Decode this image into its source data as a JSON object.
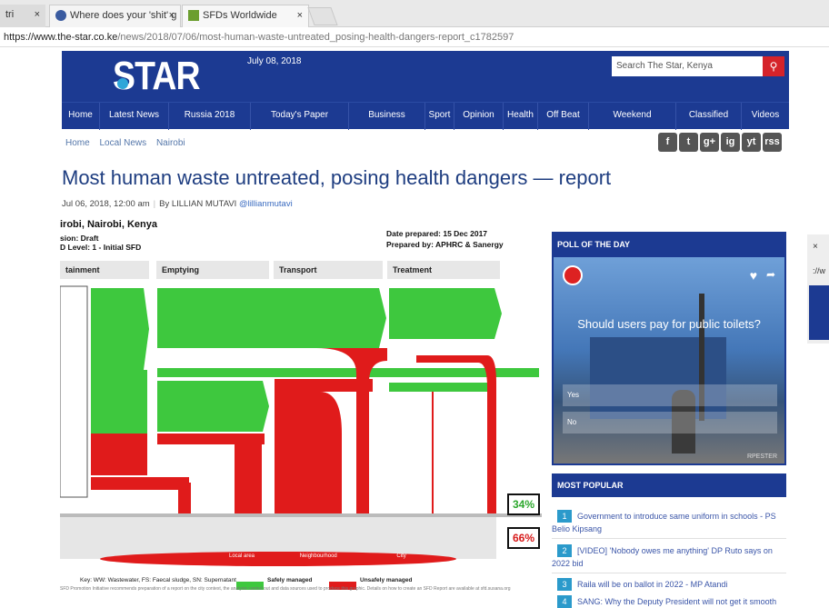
{
  "browser": {
    "tabs": [
      {
        "label": "tri"
      },
      {
        "label": "Where does your 'shit' g"
      },
      {
        "label": "SFDs Worldwide"
      }
    ],
    "url_host": "https://www.the-star.co.ke",
    "url_path": "/news/2018/07/06/most-human-waste-untreated_posing-health-dangers-report_c1782597"
  },
  "site": {
    "logo": "STAR",
    "date": "July 08, 2018",
    "search_placeholder": "Search The Star, Kenya",
    "nav": [
      "Home",
      "Latest News",
      "Russia 2018",
      "Today's Paper",
      "Business",
      "Sport",
      "Opinion",
      "Health",
      "Off Beat",
      "Weekend",
      "Classified",
      "Videos"
    ]
  },
  "breadcrumb": [
    "Home",
    "Local News",
    "Nairobi"
  ],
  "social": [
    "f",
    "t",
    "g+",
    "ig",
    "yt",
    "rss"
  ],
  "article": {
    "title": "Most human waste untreated, posing health dangers — report",
    "date": "Jul 06, 2018, 12:00 am",
    "author": "By LILLIAN MUTAVI",
    "handle": "@lillianmutavi"
  },
  "sfd": {
    "city": "irobi, Nairobi, Kenya",
    "version": "sion: Draft",
    "level": "D Level: 1 - Initial SFD",
    "prepared_date": "Date prepared: 15 Dec 2017",
    "prepared_by": "Prepared by: APHRC & Sanergy",
    "stages": [
      "tainment",
      "Emptying",
      "Transport",
      "Treatment"
    ],
    "safe_pct": "34%",
    "unsafe_pct": "66%",
    "green_color": "#3ec83e",
    "red_color": "#e01b1b",
    "key_text": "Key: WW: Wastewater, FS: Faecal sludge, SN: Supernatant",
    "key_safe": "Safely managed",
    "key_unsafe": "Unsafely managed",
    "zones": [
      "Local area",
      "Neighbourhood",
      "City"
    ],
    "footer": "SFD Promotion Initiative recommends preparation of a report on the city context, the analysis carried out and data sources used to produce this graphic. Details on how to create an SFD Report are available at sfd.susana.org"
  },
  "poll": {
    "title": "POLL OF THE DAY",
    "question": "Should users pay for public toilets?",
    "option1": "Yes",
    "option2": "No",
    "watermark": "RPESTER"
  },
  "most_popular": {
    "title": "MOST POPULAR",
    "items": [
      {
        "num": "1",
        "text": "Government to introduce same uniform in schools - PS Belio Kipsang"
      },
      {
        "num": "2",
        "text": "[VIDEO] 'Nobody owes me anything' DP Ruto says on 2022 bid"
      },
      {
        "num": "3",
        "text": "Raila will be on ballot in 2022 - MP Atandi"
      },
      {
        "num": "4",
        "text": "SANG: Why the Deputy President will not get it smooth"
      }
    ]
  },
  "side_window": {
    "close": "×",
    "url": "://w"
  }
}
